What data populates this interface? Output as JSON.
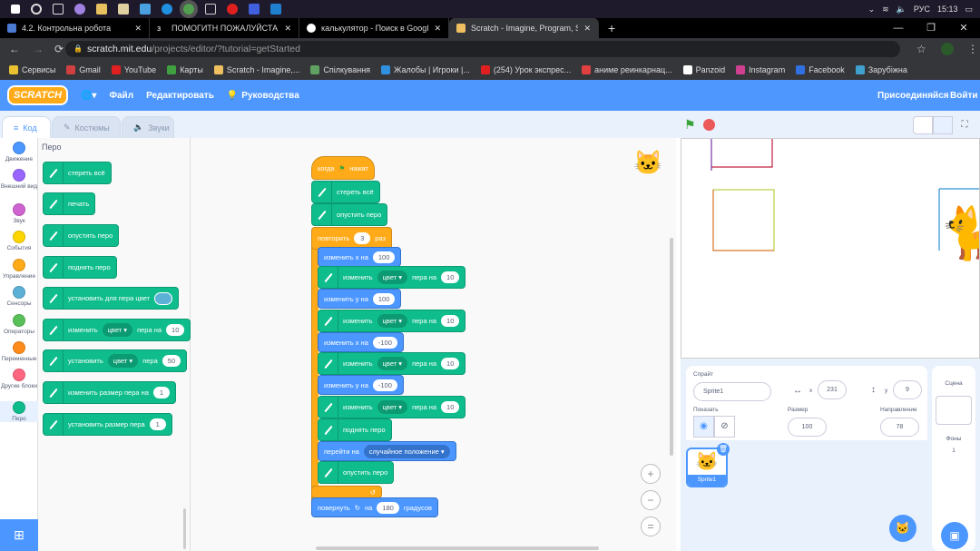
{
  "taskbar": {
    "lang": "РУС",
    "time": "15:13"
  },
  "browser": {
    "tabs": [
      {
        "label": "4.2. Контрольна робота",
        "color": "#4a7bd0"
      },
      {
        "label": "ПОМОГИТН ПОЖАЛУЙСТА! ДА",
        "color": "#000"
      },
      {
        "label": "калькулятор - Поиск в Google",
        "color": "#fff"
      },
      {
        "label": "Scratch - Imagine, Program, Share",
        "color": "#f0c060"
      }
    ],
    "new_tab": "+",
    "url_host": "scratch.mit.edu",
    "url_path": "/projects/editor/?tutorial=getStarted",
    "bookmarks": [
      "Сервисы",
      "Gmail",
      "YouTube",
      "Карты",
      "Scratch - Imagine,...",
      "Спілкування",
      "Жалобы | Игроки |...",
      "(254) Урок экспрес...",
      "аниме реинкарнац...",
      "Panzoid",
      "Instagram",
      "Facebook",
      "Зарубіжна"
    ]
  },
  "scratch": {
    "logo": "SCRATCH",
    "file": "Файл",
    "edit": "Редактировать",
    "tutorials": "Руководства",
    "join": "Присоединяйся",
    "signin": "Войти",
    "tabs": {
      "code": "Код",
      "costumes": "Костюмы",
      "sounds": "Звуки"
    },
    "categories": [
      {
        "label": "Движение",
        "color": "#4c97ff"
      },
      {
        "label": "Внешний вид",
        "color": "#9966ff"
      },
      {
        "label": "Звук",
        "color": "#cf63cf"
      },
      {
        "label": "События",
        "color": "#ffd500"
      },
      {
        "label": "Управление",
        "color": "#ffab19"
      },
      {
        "label": "Сенсоры",
        "color": "#5cb1d6"
      },
      {
        "label": "Операторы",
        "color": "#59c059"
      },
      {
        "label": "Переменные",
        "color": "#ff8c1a"
      },
      {
        "label": "Другие блоки",
        "color": "#ff6680"
      },
      {
        "label": "Перо",
        "color": "#0fbd8c"
      }
    ],
    "palette_title": "Перо",
    "palette": [
      [
        {
          "t": "стереть всё"
        }
      ],
      [
        {
          "t": "печать"
        }
      ],
      [
        {
          "t": "опустить перо"
        }
      ],
      [
        {
          "t": "поднять перо"
        }
      ],
      [
        {
          "t": "установить для пера цвет"
        },
        {
          "sw": "#5cb1d6"
        }
      ],
      [
        {
          "t": "изменить"
        },
        {
          "dd": "цвет"
        },
        {
          "t": "пера на"
        },
        {
          "in": "10"
        }
      ],
      [
        {
          "t": "установить"
        },
        {
          "dd": "цвет"
        },
        {
          "t": "пера"
        },
        {
          "in": "50"
        }
      ],
      [
        {
          "t": "изменить размер пера на"
        },
        {
          "in": "1"
        }
      ],
      [
        {
          "t": "установить размер пера"
        },
        {
          "in": "1"
        }
      ]
    ],
    "script": [
      {
        "k": "ctrl",
        "s": [
          {
            "t": "когда"
          },
          {
            "flag": 1
          },
          {
            "t": "нажат"
          }
        ]
      },
      {
        "k": "pen",
        "s": [
          {
            "t": "стереть всё"
          }
        ]
      },
      {
        "k": "pen",
        "s": [
          {
            "t": "опустить перо"
          }
        ]
      },
      {
        "k": "ctrl",
        "s": [
          {
            "t": "повторить"
          },
          {
            "in": "3"
          },
          {
            "t": "раз"
          }
        ]
      },
      {
        "k": "motion",
        "s": [
          {
            "t": "изменить х на"
          },
          {
            "in": "100"
          }
        ]
      },
      {
        "k": "pen",
        "s": [
          {
            "t": "изменить"
          },
          {
            "dd": "цвет"
          },
          {
            "t": "пера на"
          },
          {
            "in": "10"
          }
        ]
      },
      {
        "k": "motion",
        "s": [
          {
            "t": "изменить у на"
          },
          {
            "in": "100"
          }
        ]
      },
      {
        "k": "pen",
        "s": [
          {
            "t": "изменить"
          },
          {
            "dd": "цвет"
          },
          {
            "t": "пера на"
          },
          {
            "in": "10"
          }
        ]
      },
      {
        "k": "motion",
        "s": [
          {
            "t": "изменить х на"
          },
          {
            "in": "-100"
          }
        ]
      },
      {
        "k": "pen",
        "s": [
          {
            "t": "изменить"
          },
          {
            "dd": "цвет"
          },
          {
            "t": "пера на"
          },
          {
            "in": "10"
          }
        ]
      },
      {
        "k": "motion",
        "s": [
          {
            "t": "изменить у на"
          },
          {
            "in": "-100"
          }
        ]
      },
      {
        "k": "pen",
        "s": [
          {
            "t": "изменить"
          },
          {
            "dd": "цвет"
          },
          {
            "t": "пера на"
          },
          {
            "in": "10"
          }
        ]
      },
      {
        "k": "pen",
        "s": [
          {
            "t": "поднять перо"
          }
        ]
      },
      {
        "k": "motion",
        "s": [
          {
            "t": "перейти на"
          },
          {
            "dd": "случайное положение"
          }
        ]
      },
      {
        "k": "pen",
        "s": [
          {
            "t": "опустить перо"
          }
        ]
      },
      {
        "k": "ctrl",
        "s": [
          {
            "t": "↺"
          }
        ]
      },
      {
        "k": "motion",
        "s": [
          {
            "t": "повернуть"
          },
          {
            "t": "↻"
          },
          {
            "t": "на"
          },
          {
            "in": "180"
          },
          {
            "t": "градусов"
          }
        ]
      }
    ],
    "sprite": {
      "label": "Спрайт",
      "name": "Sprite1",
      "x_label": "x",
      "x": "231",
      "y_label": "y",
      "y": "9",
      "show_label": "Показать",
      "size_label": "Размер",
      "size": "100",
      "dir_label": "Направление",
      "direction": "78",
      "thumb_label": "Sprite1"
    },
    "stage_panel": {
      "label": "Сцена",
      "backdrops_label": "Фоны",
      "backdrops": "1"
    }
  }
}
